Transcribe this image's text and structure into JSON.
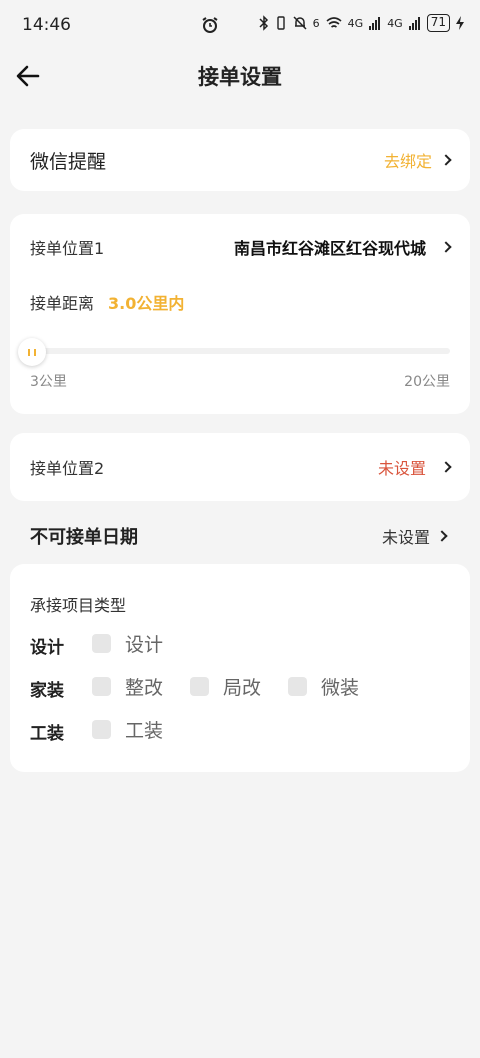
{
  "status": {
    "time": "14:46",
    "signal1": "4G",
    "signal2": "4G",
    "battery": "71",
    "wifi_badge": "6"
  },
  "header": {
    "title": "接单设置"
  },
  "wechat": {
    "label": "微信提醒",
    "action": "去绑定"
  },
  "location1": {
    "label": "接单位置1",
    "value": "南昌市红谷滩区红谷现代城",
    "distance_label": "接单距离",
    "distance_value": "3.0公里内",
    "slider_min": "3公里",
    "slider_max": "20公里",
    "slider_level": 0
  },
  "location2": {
    "label": "接单位置2",
    "value": "未设置"
  },
  "unavailable": {
    "label": "不可接单日期",
    "value": "未设置"
  },
  "project_types": {
    "title": "承接项目类型",
    "groups": [
      {
        "name": "设计",
        "options": [
          "设计"
        ]
      },
      {
        "name": "家装",
        "options": [
          "整改",
          "局改",
          "微装"
        ]
      },
      {
        "name": "工装",
        "options": [
          "工装"
        ]
      }
    ]
  },
  "colors": {
    "accent": "#f2b233",
    "warning": "#d9543c",
    "background": "#f4f4f4"
  }
}
